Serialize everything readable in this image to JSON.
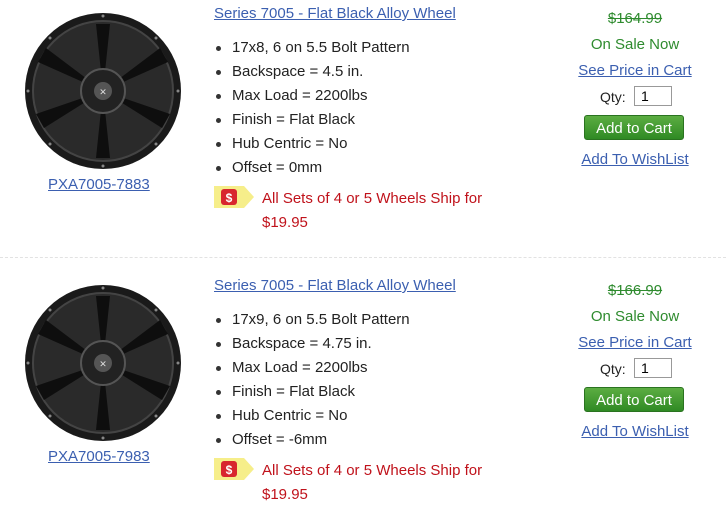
{
  "colors": {
    "link": "#3b5fb0",
    "sale_green": "#2e8b2e",
    "ship_red": "#c0121b",
    "cart_green": "#3a9a2c"
  },
  "products": [
    {
      "sku": "PXA7005-7883",
      "title": "Series 7005 - Flat Black Alloy Wheel",
      "specs": [
        "17x8, 6 on 5.5 Bolt Pattern",
        "Backspace = 4.5 in.",
        "Max Load = 2200lbs",
        "Finish = Flat Black",
        "Hub Centric = No",
        "Offset = 0mm"
      ],
      "shipping_text": "All Sets of 4 or 5 Wheels Ship for $19.95",
      "shipping_icon": "dollar-tag-icon",
      "old_price": "$164.99",
      "sale_text": "On Sale Now",
      "see_price": "See Price in Cart",
      "qty_label": "Qty:",
      "qty_value": "1",
      "add_to_cart": "Add to Cart",
      "add_to_wishlist": "Add To WishList"
    },
    {
      "sku": "PXA7005-7983",
      "title": "Series 7005 - Flat Black Alloy Wheel",
      "specs": [
        "17x9, 6 on 5.5 Bolt Pattern",
        "Backspace = 4.75 in.",
        "Max Load = 2200lbs",
        "Finish = Flat Black",
        "Hub Centric = No",
        "Offset = -6mm"
      ],
      "shipping_text": "All Sets of 4 or 5 Wheels Ship for $19.95",
      "shipping_icon": "dollar-tag-icon",
      "old_price": "$166.99",
      "sale_text": "On Sale Now",
      "see_price": "See Price in Cart",
      "qty_label": "Qty:",
      "qty_value": "1",
      "add_to_cart": "Add to Cart",
      "add_to_wishlist": "Add To WishList"
    }
  ]
}
